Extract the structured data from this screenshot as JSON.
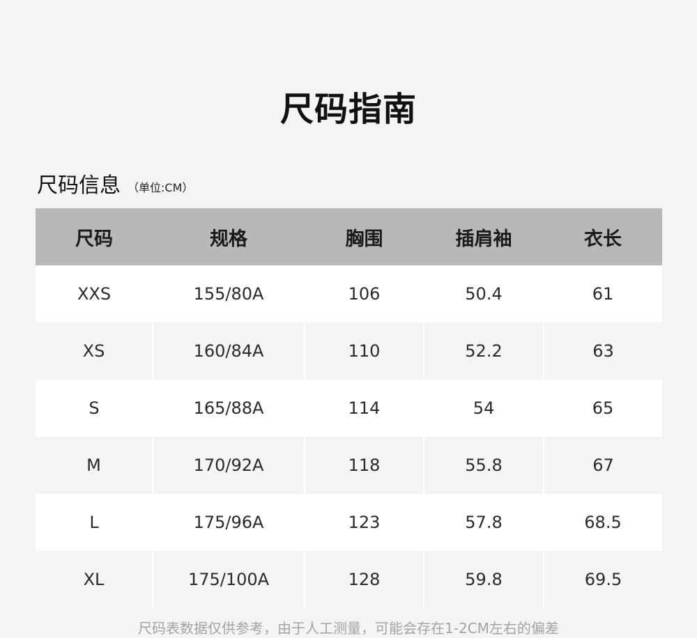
{
  "page": {
    "title": "尺码指南",
    "section_title": "尺码信息",
    "unit_note": "（单位:CM）",
    "footnote": "尺码表数据仅供参考，由于人工测量，可能会存在1-2CM左右的偏差"
  },
  "table": {
    "headers": [
      "尺码",
      "规格",
      "胸围",
      "插肩袖",
      "衣长"
    ],
    "rows": [
      [
        "XXS",
        "155/80A",
        "106",
        "50.4",
        "61"
      ],
      [
        "XS",
        "160/84A",
        "110",
        "52.2",
        "63"
      ],
      [
        "S",
        "165/88A",
        "114",
        "54",
        "65"
      ],
      [
        "M",
        "170/92A",
        "118",
        "55.8",
        "67"
      ],
      [
        "L",
        "175/96A",
        "123",
        "57.8",
        "68.5"
      ],
      [
        "XL",
        "175/100A",
        "128",
        "59.8",
        "69.5"
      ]
    ]
  },
  "colors": {
    "background": "#f4f4f4",
    "header_background": "#b8b8b8",
    "row_white": "#ffffff",
    "footnote_text": "#a3a3a3"
  }
}
